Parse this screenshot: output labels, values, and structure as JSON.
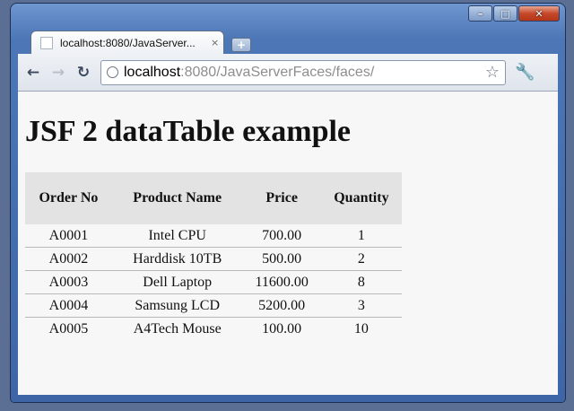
{
  "browser": {
    "tab_title": "localhost:8080/JavaServer...",
    "tab_close": "×",
    "new_tab": "+",
    "url_host": "localhost",
    "url_rest": ":8080/JavaServerFaces/faces/",
    "controls": {
      "minimize": "–",
      "maximize": "□",
      "close": "✕"
    },
    "icons": {
      "back": "back-arrow-icon",
      "forward": "forward-arrow-icon",
      "reload": "reload-icon",
      "bookmark": "star-icon",
      "settings": "wrench-icon"
    }
  },
  "page": {
    "heading": "JSF 2 dataTable example",
    "table": {
      "headers": [
        "Order No",
        "Product Name",
        "Price",
        "Quantity"
      ],
      "rows": [
        [
          "A0001",
          "Intel CPU",
          "700.00",
          "1"
        ],
        [
          "A0002",
          "Harddisk 10TB",
          "500.00",
          "2"
        ],
        [
          "A0003",
          "Dell Laptop",
          "11600.00",
          "8"
        ],
        [
          "A0004",
          "Samsung LCD",
          "5200.00",
          "3"
        ],
        [
          "A0005",
          "A4Tech Mouse",
          "100.00",
          "10"
        ]
      ]
    }
  },
  "colors": {
    "header_bg": "#e3e3e3",
    "page_bg": "#f7f7f7",
    "title_bar": "#4c76b6"
  }
}
